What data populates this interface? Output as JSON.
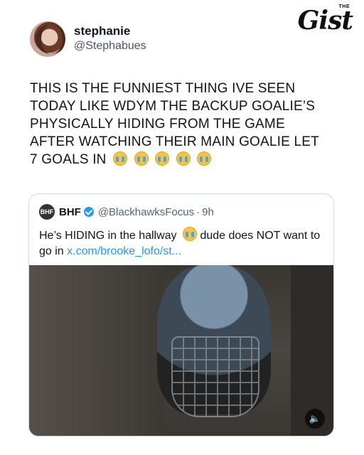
{
  "brand": {
    "logo_text": "Gist",
    "logo_small": "THE"
  },
  "author": {
    "display_name": "stephanie",
    "handle": "@Stephabues"
  },
  "tweet": {
    "text": "THIS IS THE FUNNIEST THING IVE SEEN TODAY LIKE WDYM THE BACKUP GOALIE’S PHYSICALLY HIDING FROM THE GAME AFTER WATCHING THEIR MAIN GOALIE LET 7 GOALS IN",
    "emoji_icons": [
      "crying-face-icon",
      "crying-face-icon",
      "crying-face-icon",
      "crying-face-icon",
      "crying-face-icon"
    ]
  },
  "quote": {
    "avatar_text": "BHF",
    "display_name": "BHF",
    "handle": "@BlackhawksFocus",
    "separator": "·",
    "time": "9h",
    "text_before": "He’s HIDING in the hallway",
    "text_after": "dude does NOT want to go in",
    "link": "x.com/brooke_lofo/st...",
    "emoji_icon": "crying-face-icon",
    "sound_icon": "speaker-icon",
    "sound_glyph": "🔈"
  },
  "colors": {
    "link": "#1d9bf0",
    "verified": "#1d9bf0"
  }
}
